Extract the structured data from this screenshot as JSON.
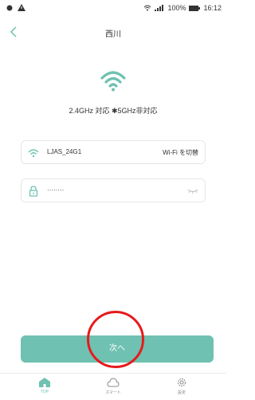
{
  "statusbar": {
    "battery": "100%",
    "time": "16:12"
  },
  "header": {
    "title": "西川"
  },
  "main": {
    "band_text": "2.4GHz 対応 ✱5GHz非対応",
    "ssid": "LJAS_24G1",
    "switch_wifi": "Wi-Fi を切替",
    "password_masked": "········"
  },
  "actions": {
    "next_label": "次へ"
  },
  "tabs": [
    {
      "label": "TOP",
      "icon": "home-icon"
    },
    {
      "label": "スマート",
      "icon": "cloud-icon"
    },
    {
      "label": "設定",
      "icon": "gear-icon"
    }
  ],
  "colors": {
    "accent": "#6fc1b2",
    "annotation": "#e61b1b"
  }
}
